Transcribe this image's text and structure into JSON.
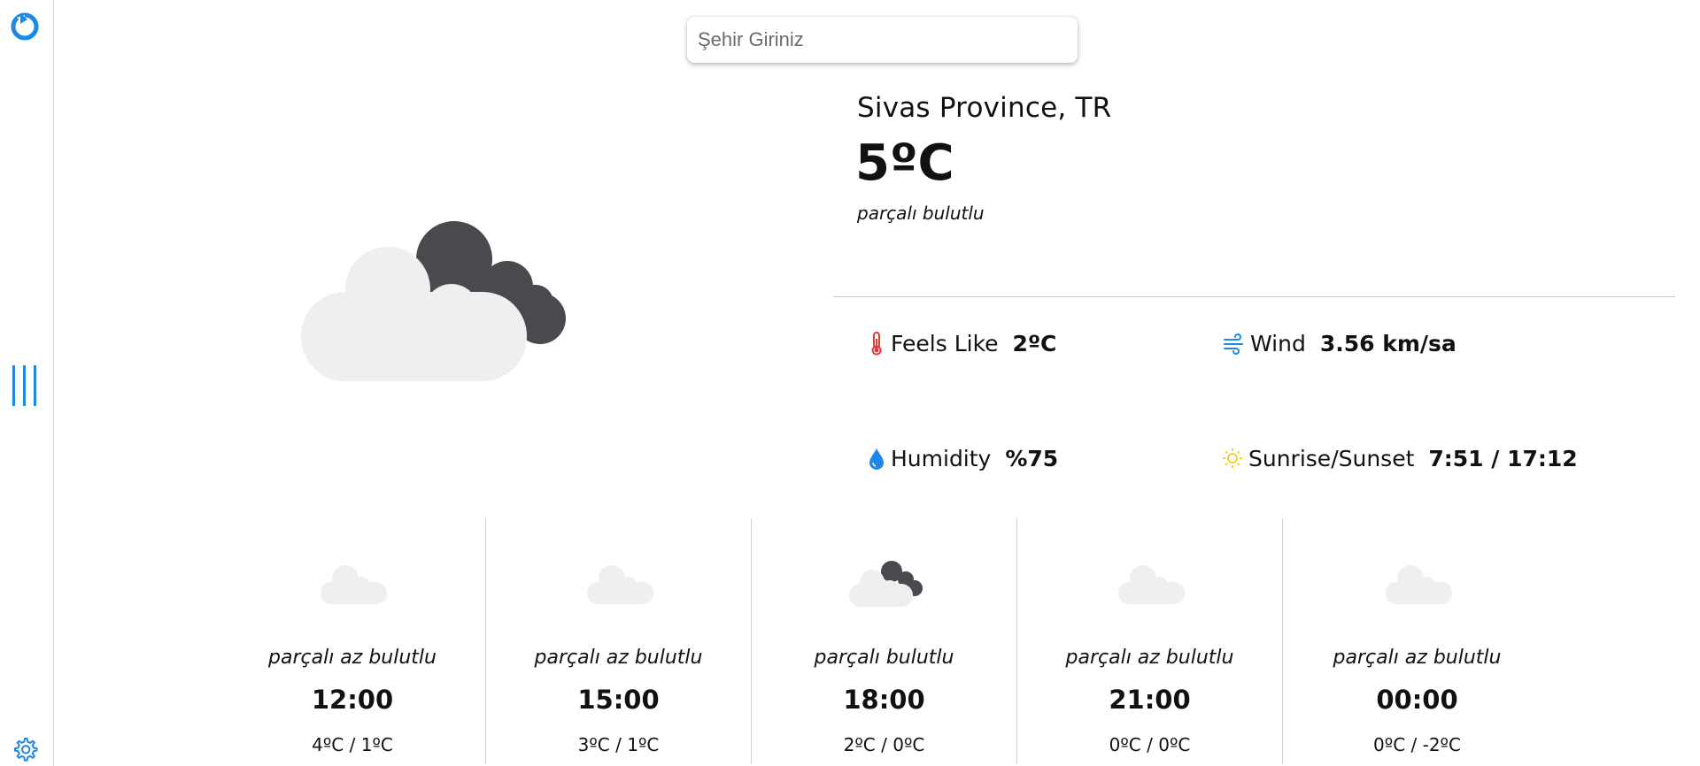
{
  "search": {
    "placeholder": "Şehir Giriniz",
    "value": ""
  },
  "current": {
    "location": "Sivas Province, TR",
    "temperature": "5ºC",
    "description": "parçalı bulutlu",
    "icon": "broken-clouds-icon"
  },
  "stats": {
    "feels_like": {
      "label": "Feels Like",
      "value": "2ºC",
      "icon": "thermometer-icon"
    },
    "wind": {
      "label": "Wind",
      "value": "3.56 km/sa",
      "icon": "wind-icon"
    },
    "humidity": {
      "label": "Humidity",
      "value": "%75",
      "icon": "water-drop-icon"
    },
    "sun": {
      "label": "Sunrise/Sunset",
      "value": "7:51 / 17:12",
      "icon": "sun-icon"
    }
  },
  "forecast": [
    {
      "description": "parçalı az bulutlu",
      "time": "12:00",
      "range": "4ºC / 1ºC",
      "icon": "few-clouds-icon"
    },
    {
      "description": "parçalı az bulutlu",
      "time": "15:00",
      "range": "3ºC / 1ºC",
      "icon": "few-clouds-icon"
    },
    {
      "description": "parçalı bulutlu",
      "time": "18:00",
      "range": "2ºC / 0ºC",
      "icon": "broken-clouds-icon"
    },
    {
      "description": "parçalı az bulutlu",
      "time": "21:00",
      "range": "0ºC / 0ºC",
      "icon": "few-clouds-icon"
    },
    {
      "description": "parçalı az bulutlu",
      "time": "00:00",
      "range": "0ºC / -2ºC",
      "icon": "few-clouds-icon"
    }
  ],
  "colors": {
    "accent": "#1E88E5",
    "light_cloud": "#EFEFEF",
    "dark_cloud": "#4A4A4E",
    "thermometer": "#E53935",
    "sun": "#F2D22E"
  }
}
